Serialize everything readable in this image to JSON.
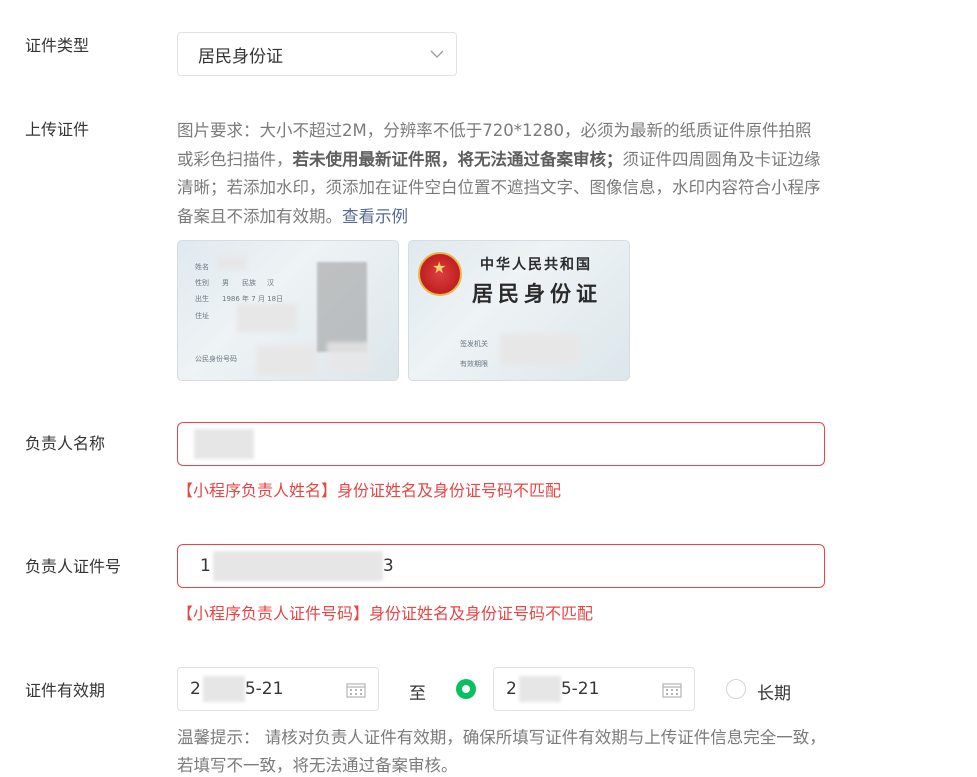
{
  "doc_type": {
    "label": "证件类型",
    "selected": "居民身份证",
    "chevron_icon": "chevron-down-icon"
  },
  "upload": {
    "label": "上传证件",
    "req_part1": "图片要求：大小不超过2M，分辨率不低于720*1280，必须为最新的纸质证件原件拍照或彩色扫描件，",
    "req_bold": "若未使用最新证件照，将无法通过备案审核；",
    "req_part2": "须证件四周圆角及卡证边缘清晰；若添加水印，须添加在证件空白位置不遮挡文字、图像信息，水印内容符合小程序备案且不添加有效期。",
    "example_link": "查看示例",
    "front_card": {
      "field_name": "姓名",
      "field_sex": "性别",
      "sex_value": "男",
      "field_ethnic": "民族",
      "ethnic_value": "汉",
      "field_birth": "出生",
      "birth_value": "1986 年 7 月 18日",
      "field_addr": "住址",
      "field_idno": "公民身份号码"
    },
    "back_card": {
      "title1": "中华人民共和国",
      "title2": "居民身份证",
      "field_issuer": "签发机关",
      "field_valid": "有效期限"
    }
  },
  "person_name": {
    "label": "负责人名称",
    "error": "【小程序负责人姓名】身份证姓名及身份证号码不匹配"
  },
  "person_id": {
    "label": "负责人证件号",
    "value_start": "1",
    "value_end": "3",
    "error": "【小程序负责人证件号码】身份证姓名及身份证号码不匹配"
  },
  "validity": {
    "label": "证件有效期",
    "start_prefix": "2",
    "start_suffix": "5-21",
    "to": "至",
    "end_prefix": "2",
    "end_suffix": "5-21",
    "long_term": "长期",
    "calendar_icon": "calendar-icon",
    "hint": "温馨提示： 请核对负责人证件有效期，确保所填写证件有效期与上传证件信息完全一致，若填写不一致，将无法通过备案审核。"
  },
  "colors": {
    "error": "#e84545",
    "accent_green": "#07c160",
    "link": "#576b95"
  }
}
